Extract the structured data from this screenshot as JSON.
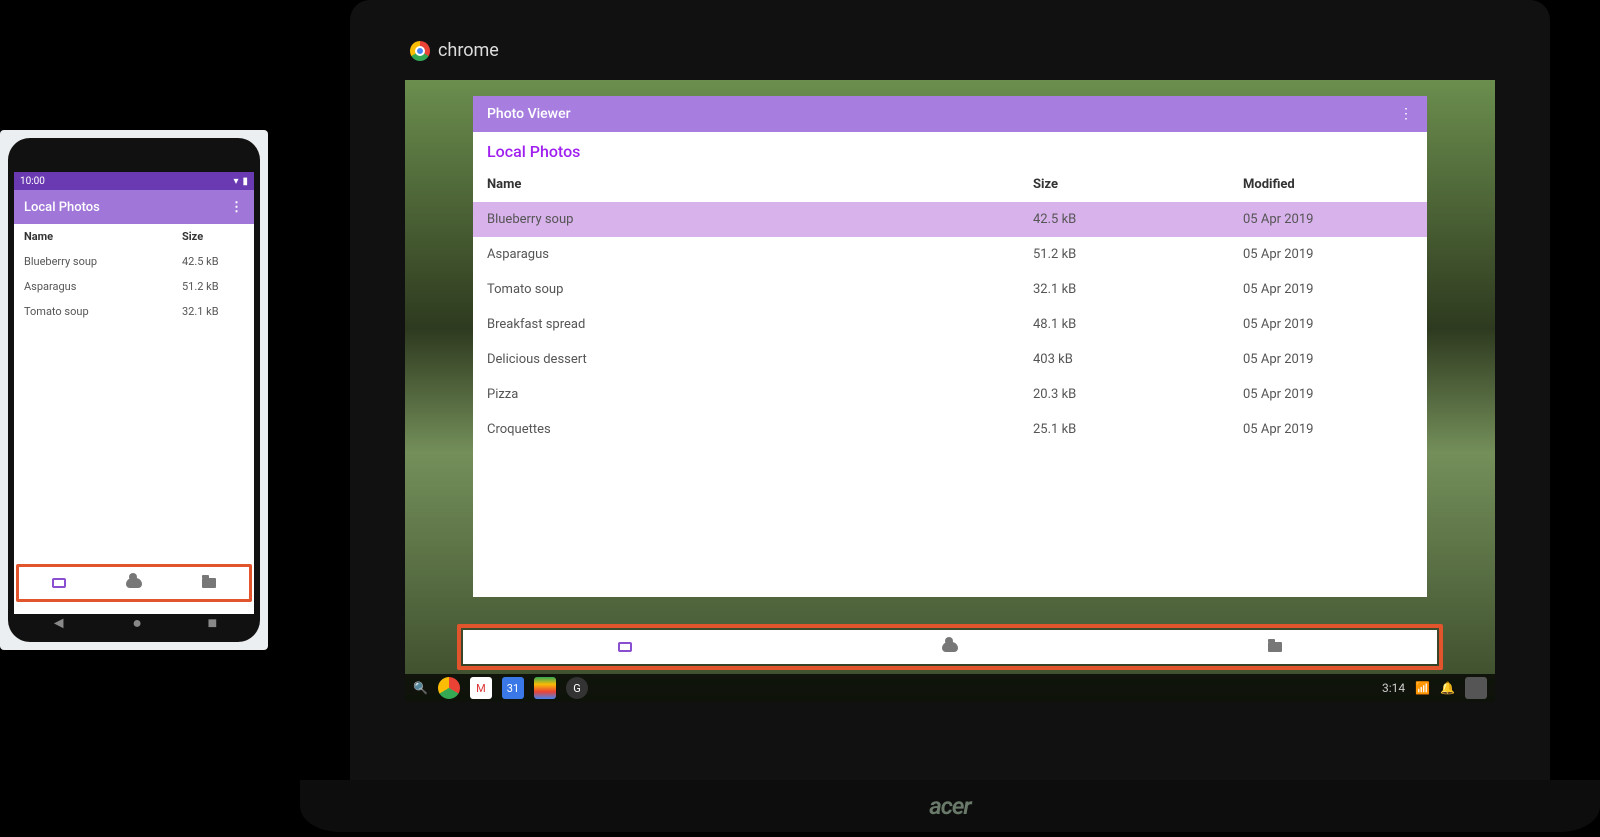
{
  "chrome_brand": "chrome",
  "laptop_brand": "acer",
  "phone": {
    "time": "10:00",
    "app_title": "Local Photos",
    "columns": {
      "name": "Name",
      "size": "Size"
    },
    "rows": [
      {
        "name": "Blueberry soup",
        "size": "42.5 kB"
      },
      {
        "name": "Asparagus",
        "size": "51.2 kB"
      },
      {
        "name": "Tomato soup",
        "size": "32.1 kB"
      }
    ],
    "nav": {
      "photos": "photos-icon",
      "cloud": "cloud-icon",
      "folder": "folder-icon"
    }
  },
  "app": {
    "title": "Photo Viewer",
    "subtitle": "Local Photos",
    "columns": {
      "name": "Name",
      "size": "Size",
      "modified": "Modified"
    },
    "rows": [
      {
        "name": "Blueberry soup",
        "size": "42.5 kB",
        "modified": "05 Apr 2019",
        "selected": true
      },
      {
        "name": "Asparagus",
        "size": "51.2 kB",
        "modified": "05 Apr 2019"
      },
      {
        "name": "Tomato soup",
        "size": "32.1 kB",
        "modified": "05 Apr 2019"
      },
      {
        "name": "Breakfast spread",
        "size": "48.1 kB",
        "modified": "05 Apr 2019"
      },
      {
        "name": "Delicious dessert",
        "size": "403 kB",
        "modified": "05 Apr 2019"
      },
      {
        "name": "Pizza",
        "size": "20.3 kB",
        "modified": "05 Apr 2019"
      },
      {
        "name": "Croquettes",
        "size": "25.1 kB",
        "modified": "05 Apr 2019"
      }
    ],
    "nav": {
      "photos": "photos-icon",
      "cloud": "cloud-icon",
      "folder": "folder-icon"
    }
  },
  "taskbar": {
    "time": "3:14"
  }
}
